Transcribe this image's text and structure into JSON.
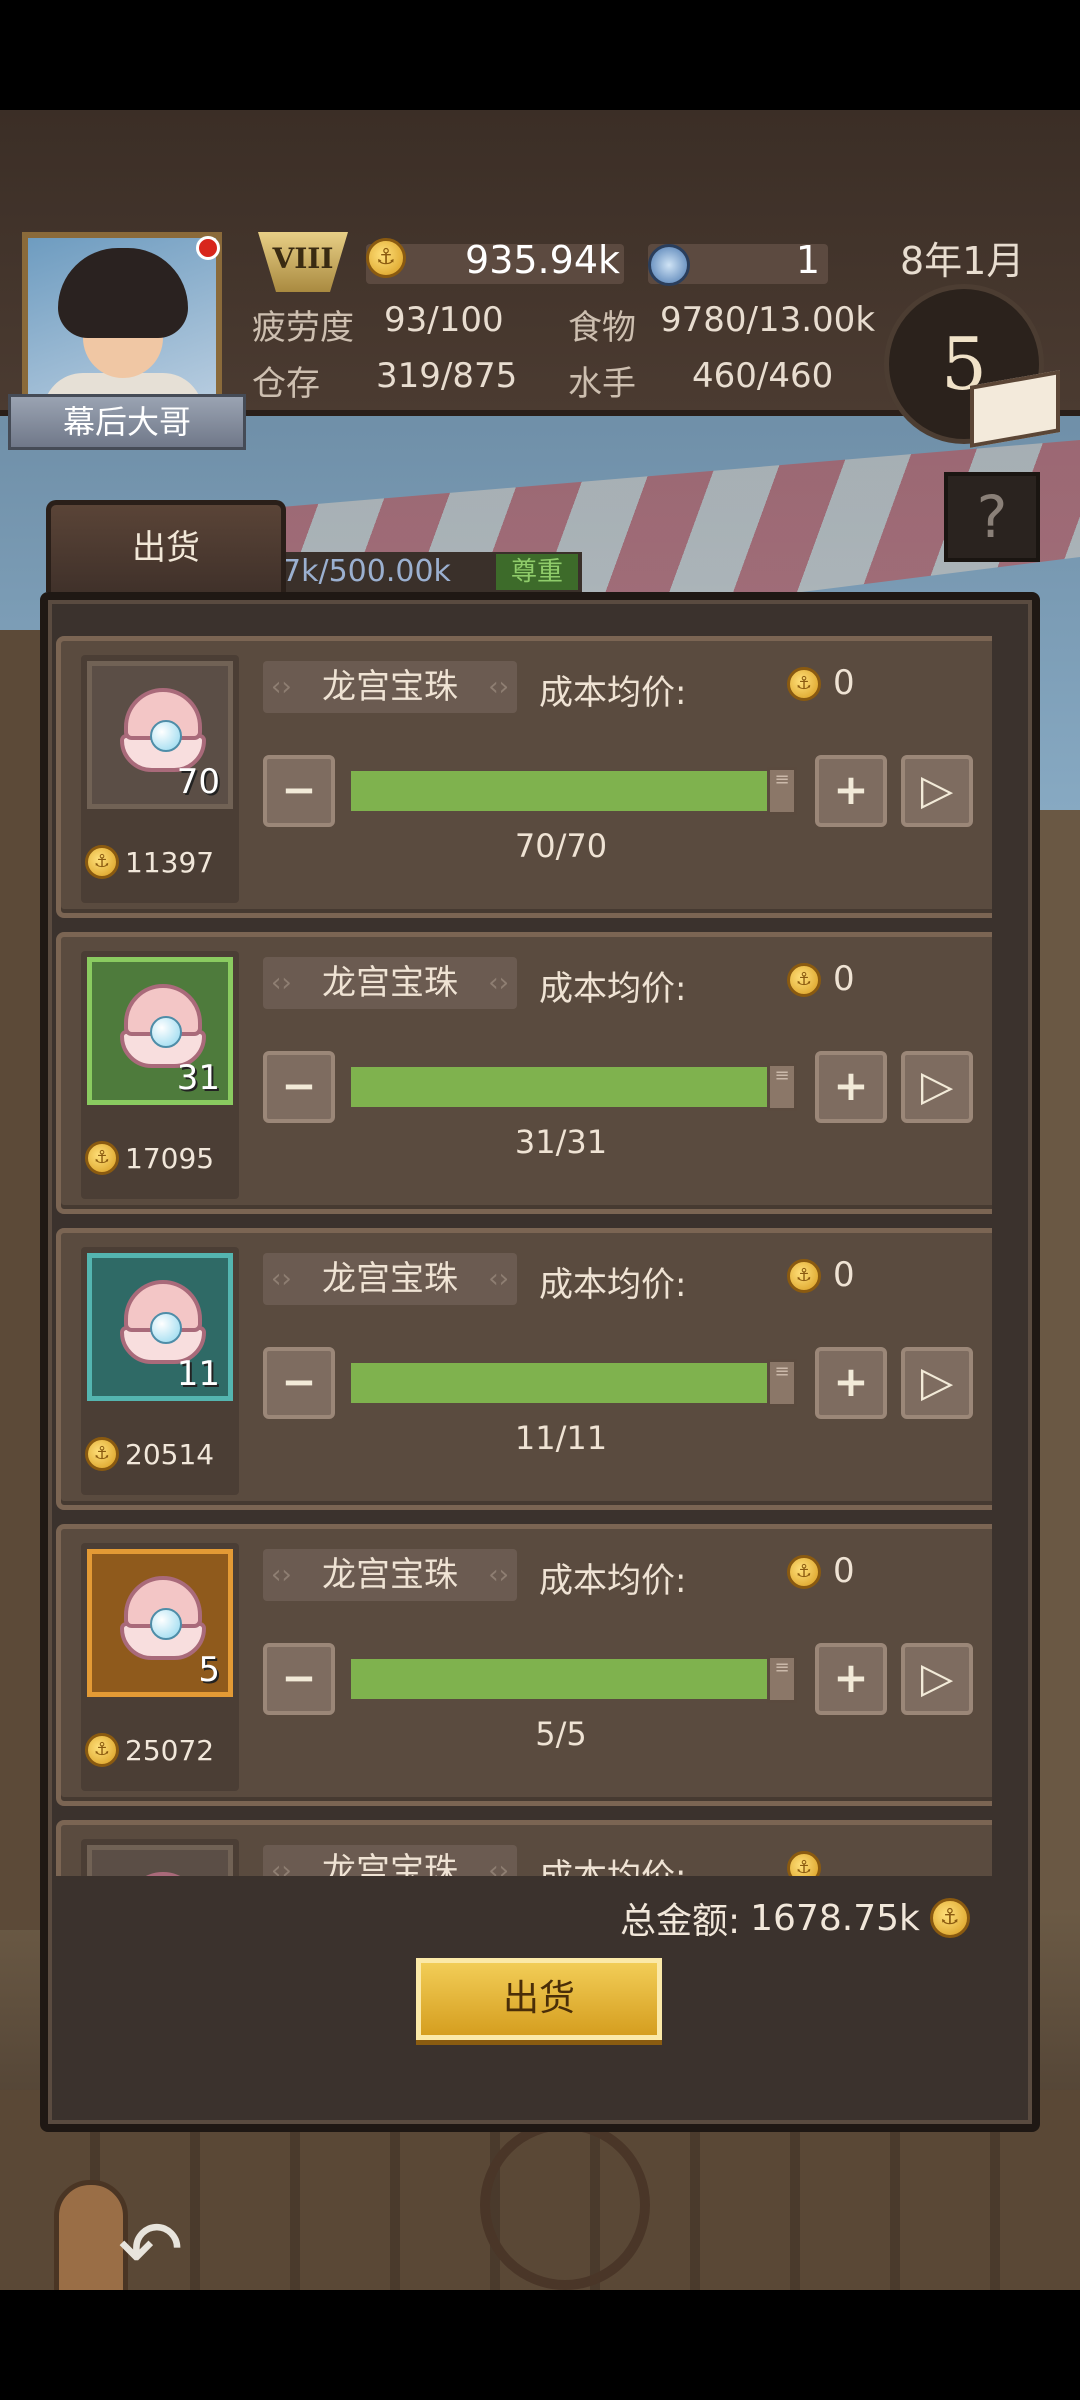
{
  "player": {
    "name": "幕后大哥",
    "rank": "VIII"
  },
  "resources": {
    "gold": "935.94k",
    "gems": "1"
  },
  "date": "8年1月",
  "turn": "5",
  "stats": [
    {
      "label": "疲劳度",
      "value": "93/100"
    },
    {
      "label": "食物",
      "value": "9780/13.00k"
    },
    {
      "label": "仓存",
      "value": "319/875"
    },
    {
      "label": "水手",
      "value": "460/460"
    }
  ],
  "help_label": "?",
  "tab": {
    "label": "出货"
  },
  "cargo_strip": {
    "text": "7k/500.00k",
    "tag": "尊重"
  },
  "items": [
    {
      "name": "龙宫宝珠",
      "qty": "70",
      "price": "11397",
      "cost_label": "成本均价:",
      "cost": "0",
      "count": "70/70",
      "frame": "gray",
      "fill": 1.0
    },
    {
      "name": "龙宫宝珠",
      "qty": "31",
      "price": "17095",
      "cost_label": "成本均价:",
      "cost": "0",
      "count": "31/31",
      "frame": "green",
      "fill": 1.0
    },
    {
      "name": "龙宫宝珠",
      "qty": "11",
      "price": "20514",
      "cost_label": "成本均价:",
      "cost": "0",
      "count": "11/11",
      "frame": "teal",
      "fill": 1.0
    },
    {
      "name": "龙宫宝珠",
      "qty": "5",
      "price": "25072",
      "cost_label": "成本均价:",
      "cost": "0",
      "count": "5/5",
      "frame": "orange",
      "fill": 1.0
    },
    {
      "name": "龙宫宝珠",
      "qty": "",
      "price": "",
      "cost_label": "成本均价:",
      "cost": "",
      "count": "",
      "frame": "gray",
      "fill": 1.0
    }
  ],
  "controls": {
    "minus": "−",
    "plus": "+",
    "max": "▷"
  },
  "total": {
    "label": "总金额:",
    "value": "1678.75k"
  },
  "ship_button": "出货",
  "colors": {
    "fill_green": "#7fb24e",
    "gold_button": "#e2b43a",
    "panel": "#3b322d"
  }
}
